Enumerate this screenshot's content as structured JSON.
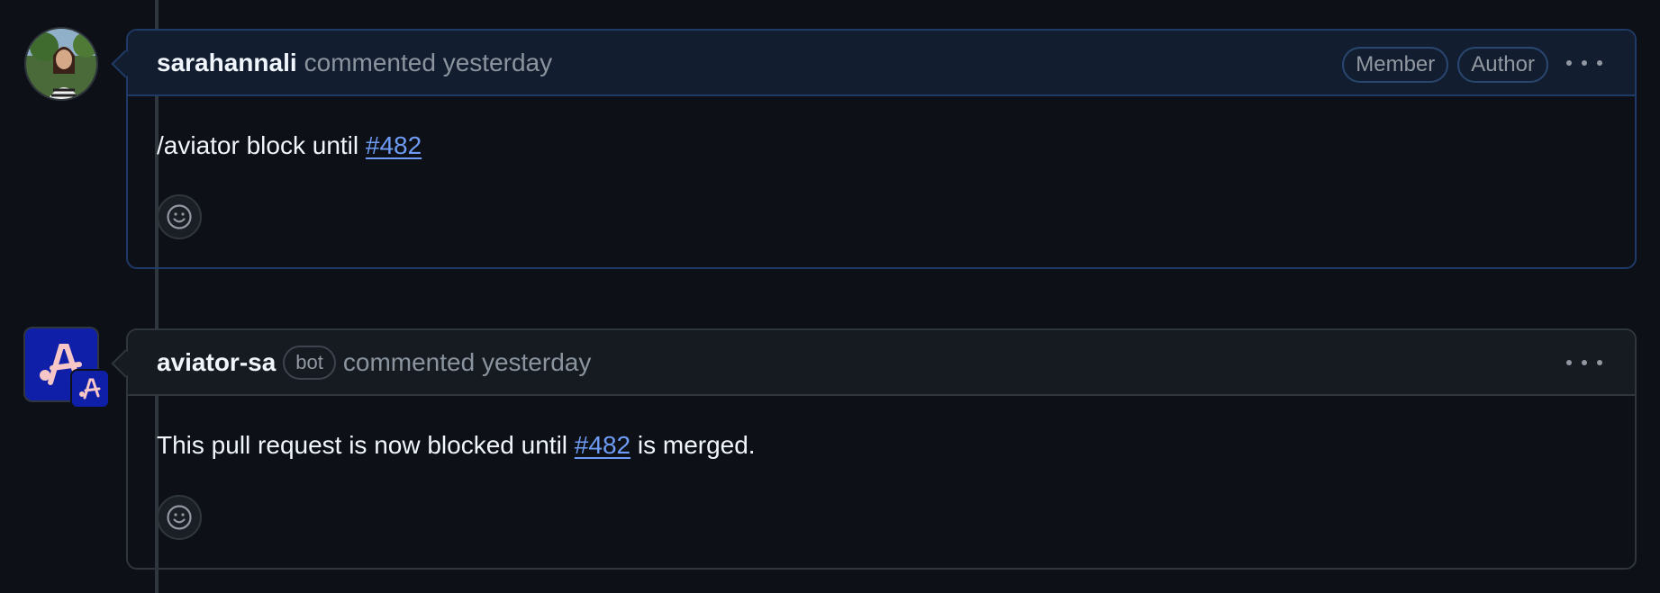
{
  "comments": [
    {
      "author": "sarahannali",
      "meta": "commented yesterday",
      "badges": [
        "Member",
        "Author"
      ],
      "body_prefix": "/aviator block until ",
      "body_link": "#482",
      "body_suffix": ""
    },
    {
      "author": "aviator-sa",
      "bot_badge": "bot",
      "meta": "commented yesterday",
      "body_prefix": "This pull request is now blocked until ",
      "body_link": "#482",
      "body_suffix": " is merged."
    }
  ],
  "icons": {
    "menu": "kebab-horizontal-icon",
    "reaction": "smiley-icon",
    "bot_logo": "aviator-logo-icon"
  },
  "colors": {
    "background": "#0d1117",
    "link": "#6e9bf5",
    "highlight_border": "#1f3a66",
    "bot_avatar": "#0f1fa8"
  }
}
